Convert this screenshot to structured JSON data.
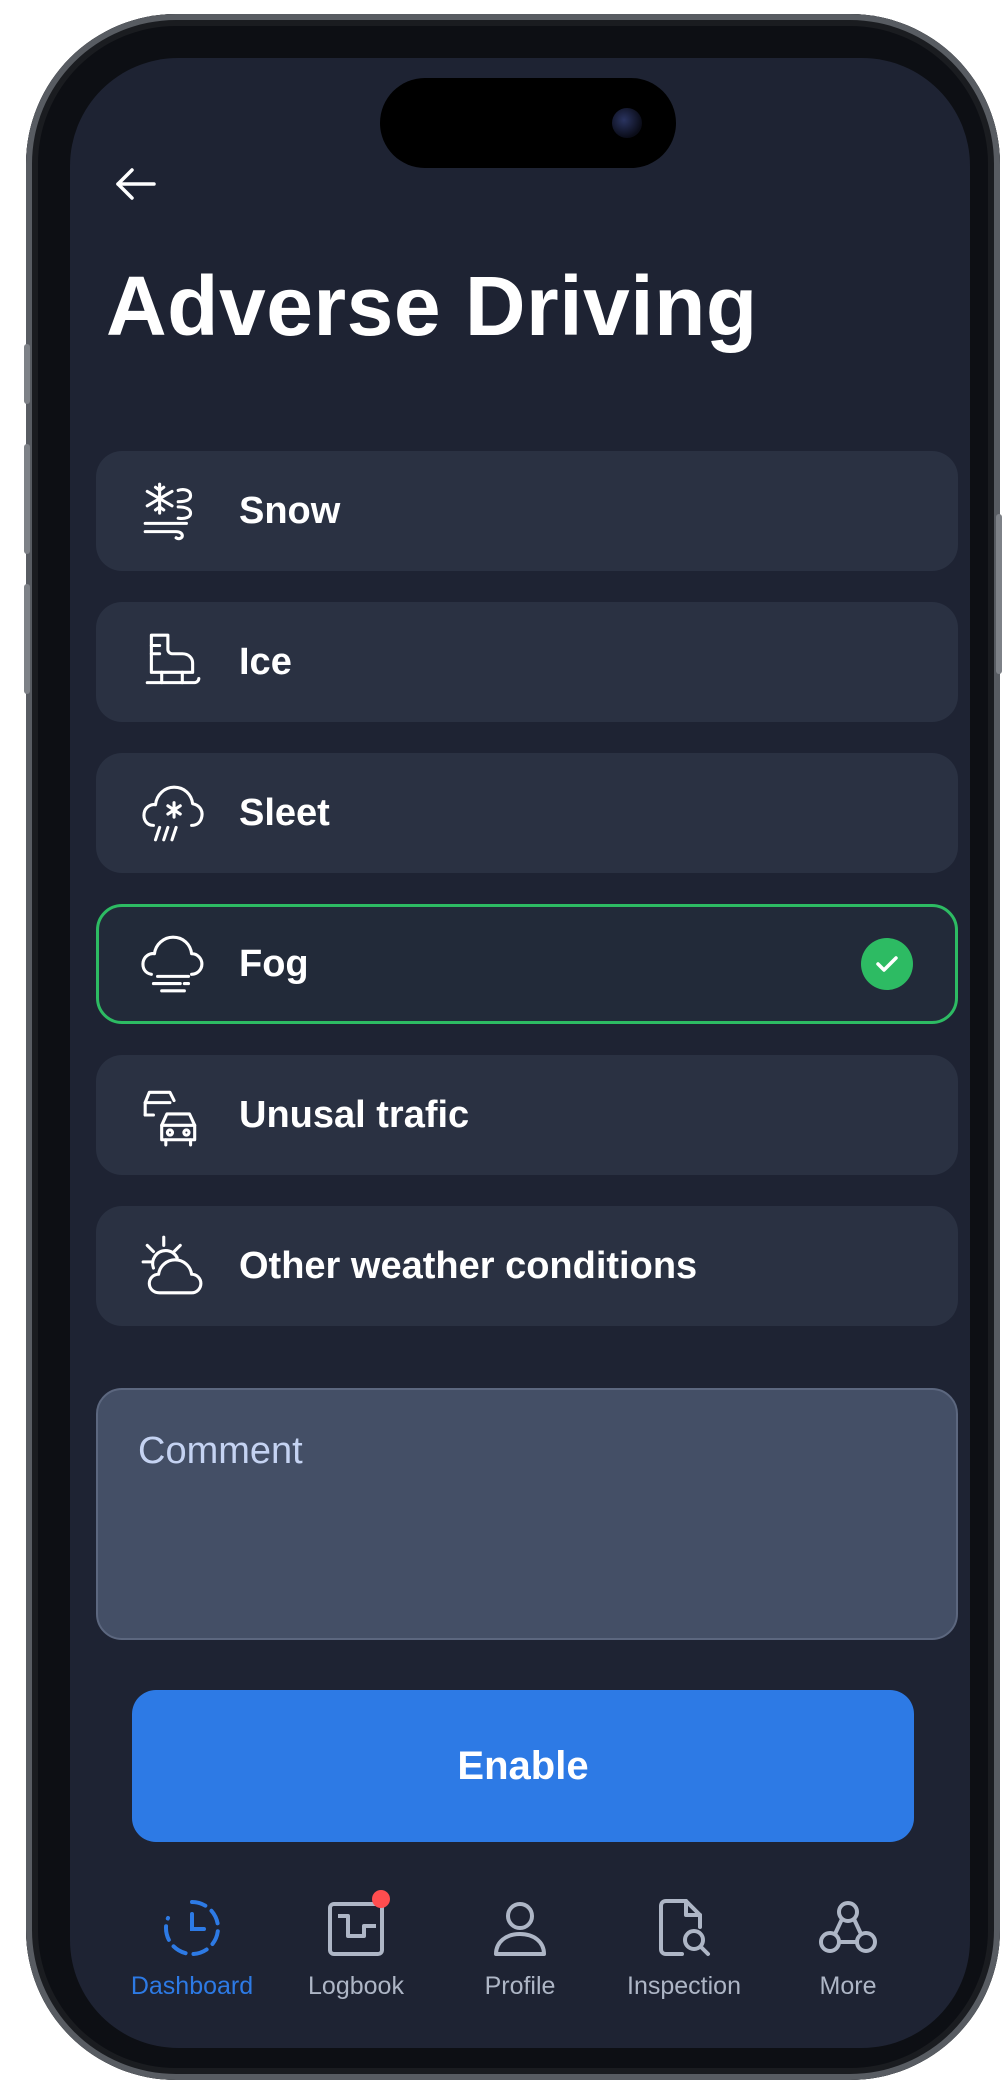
{
  "header": {
    "title": "Adverse Driving"
  },
  "conditions": [
    {
      "label": "Snow",
      "icon": "snow-wind-icon",
      "selected": false
    },
    {
      "label": "Ice",
      "icon": "ice-skate-icon",
      "selected": false
    },
    {
      "label": "Sleet",
      "icon": "sleet-cloud-icon",
      "selected": false
    },
    {
      "label": "Fog",
      "icon": "fog-cloud-icon",
      "selected": true
    },
    {
      "label": "Unusal trafic",
      "icon": "traffic-cars-icon",
      "selected": false
    },
    {
      "label": "Other weather conditions",
      "icon": "sun-cloud-icon",
      "selected": false
    }
  ],
  "comment": {
    "placeholder": "Comment",
    "value": ""
  },
  "actions": {
    "enable_label": "Enable"
  },
  "tabbar": [
    {
      "label": "Dashboard",
      "icon": "dashboard-clock-icon",
      "active": true
    },
    {
      "label": "Logbook",
      "icon": "logbook-icon",
      "active": false,
      "badge": true
    },
    {
      "label": "Profile",
      "icon": "profile-user-icon",
      "active": false
    },
    {
      "label": "Inspection",
      "icon": "inspection-document-icon",
      "active": false
    },
    {
      "label": "More",
      "icon": "more-nodes-icon",
      "active": false
    }
  ],
  "colors": {
    "background": "#1e2333",
    "card": "#2a3142",
    "selected_border": "#2dbb63",
    "primary": "#2d7ae5",
    "comment_bg": "#444f66"
  }
}
